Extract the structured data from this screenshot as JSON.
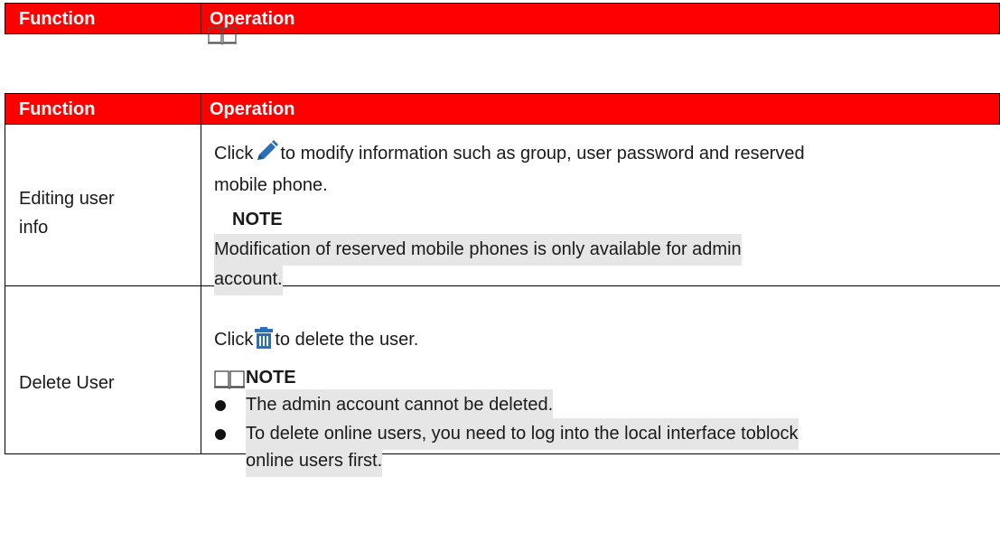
{
  "top_header": {
    "function": "Function",
    "operation": "Operation"
  },
  "table": {
    "header": {
      "function": "Function",
      "operation": "Operation"
    },
    "rows": [
      {
        "function_line1": "Editing user",
        "function_line2": "info",
        "line1_pre": "Click",
        "line1_post": "to modify information such as group, user password and reserved",
        "line2": "mobile phone.",
        "note_label": "NOTE",
        "note_line1": "Modification of reserved mobile phones is only available for admin",
        "note_line2": "account."
      },
      {
        "function": "Delete User",
        "line1_pre": "Click",
        "line1_post": "to delete the user.",
        "note_label": "NOTE",
        "bullet1": "The admin account cannot be deleted.",
        "bullet2_line1": "To delete online users, you need to log into the local interface toblock",
        "bullet2_line2": "online users first."
      }
    ]
  },
  "colors": {
    "header_bg": "#ff0000",
    "highlight": "#e6e6e6",
    "icon_blue": "#2b6fb8"
  },
  "icons": [
    "book-icon",
    "pencil-icon",
    "trash-icon"
  ]
}
